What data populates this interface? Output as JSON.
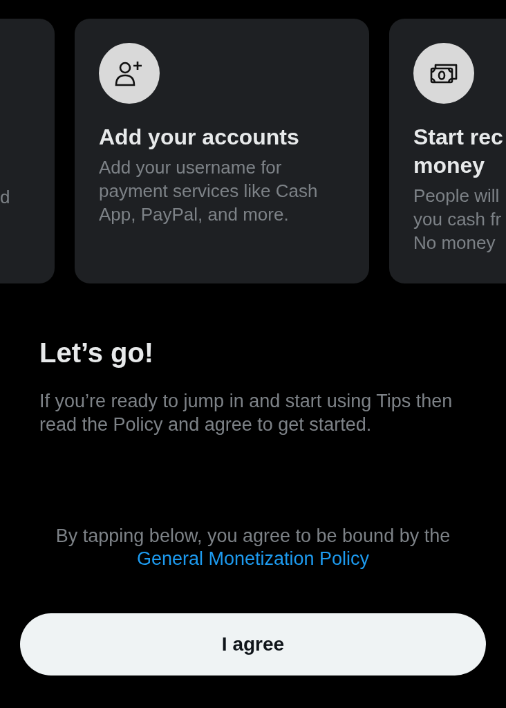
{
  "cards": [
    {
      "kind": "clipped",
      "body_lines": [
        "d"
      ]
    },
    {
      "kind": "accounts",
      "title_lines": [
        "Add your accounts"
      ],
      "body_lines": [
        "Add your username for",
        "payment services like Cash",
        "App, PayPal, and more."
      ]
    },
    {
      "kind": "money",
      "title_lines": [
        "Start rec",
        "money"
      ],
      "body_lines": [
        "People will",
        "you cash fr",
        "No money"
      ]
    }
  ],
  "heading": "Let’s go!",
  "intro": "If you’re ready to jump in and start using Tips then read the Policy and agree to get started.",
  "consent": {
    "text": "By tapping below, you agree to be bound by the",
    "link": "General Monetization Policy"
  },
  "agree_button": "I agree"
}
